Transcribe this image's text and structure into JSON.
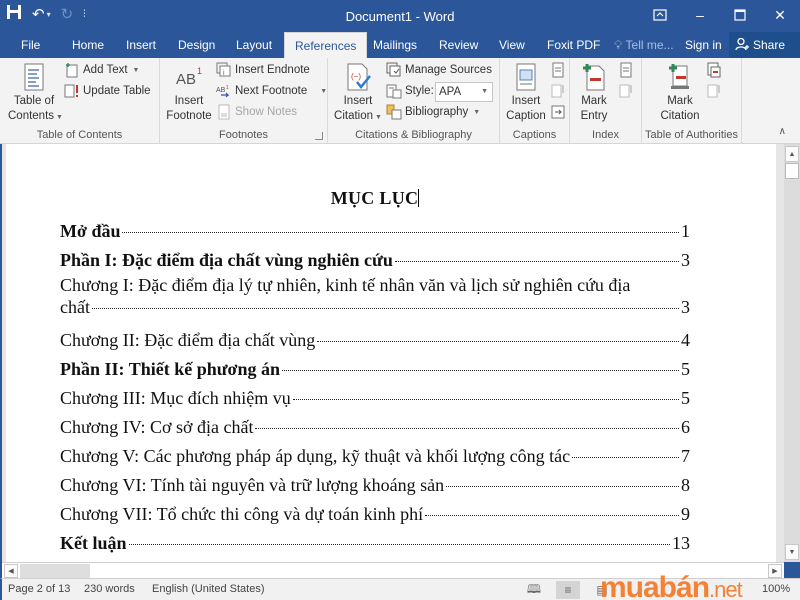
{
  "window": {
    "title": "Document1 - Word",
    "controls": [
      "ribbon-display-options",
      "minimize",
      "maximize",
      "close"
    ]
  },
  "qat": {
    "save_icon": "save-icon",
    "undo_icon": "undo-icon",
    "redo_icon": "redo-icon",
    "customize_icon": "customize-qat-icon"
  },
  "tabs": [
    {
      "label": "File"
    },
    {
      "label": "Home"
    },
    {
      "label": "Insert"
    },
    {
      "label": "Design"
    },
    {
      "label": "Layout"
    },
    {
      "label": "References",
      "active": true
    },
    {
      "label": "Mailings"
    },
    {
      "label": "Review"
    },
    {
      "label": "View"
    },
    {
      "label": "Foxit PDF"
    }
  ],
  "tell_me": "Tell me...",
  "sign_in": "Sign in",
  "share": "Share",
  "ribbon": {
    "groups": {
      "toc": {
        "label": "Table of Contents",
        "toc_button_line1": "Table of",
        "toc_button_line2": "Contents",
        "add_text": "Add Text",
        "update_table": "Update Table"
      },
      "footnotes": {
        "label": "Footnotes",
        "insert_footnote_line1": "Insert",
        "insert_footnote_line2": "Footnote",
        "insert_endnote": "Insert Endnote",
        "next_footnote": "Next Footnote",
        "show_notes": "Show Notes"
      },
      "citations": {
        "label": "Citations & Bibliography",
        "insert_citation_line1": "Insert",
        "insert_citation_line2": "Citation",
        "manage_sources": "Manage Sources",
        "style_label": "Style:",
        "style_value": "APA",
        "bibliography": "Bibliography"
      },
      "captions": {
        "label": "Captions",
        "insert_caption_line1": "Insert",
        "insert_caption_line2": "Caption"
      },
      "index": {
        "label": "Index",
        "mark_entry_line1": "Mark",
        "mark_entry_line2": "Entry"
      },
      "authorities": {
        "label": "Table of Authorities",
        "mark_citation_line1": "Mark",
        "mark_citation_line2": "Citation"
      }
    }
  },
  "document": {
    "title": "MỤC LỤC",
    "toc": [
      {
        "text": "Mở đầu",
        "page": "1",
        "bold": true
      },
      {
        "text": "Phần I: Đặc điểm địa chất vùng nghiên cứu",
        "page": "3",
        "bold": true
      },
      {
        "text": "Chương I: Đặc điểm địa lý tự nhiên, kinh tế nhân văn và lịch sử nghiên cứu địa",
        "text_cont": "chất",
        "page": "3",
        "bold": false
      },
      {
        "text": "Chương II: Đặc điểm địa chất vùng",
        "page": "4",
        "bold": false
      },
      {
        "text": "Phần II: Thiết kế phương án",
        "page": "5",
        "bold": true
      },
      {
        "text": "Chương III: Mục đích nhiệm vụ",
        "page": "5",
        "bold": false
      },
      {
        "text": "Chương IV: Cơ sở địa chất",
        "page": "6",
        "bold": false
      },
      {
        "text": "Chương V: Các phương pháp áp dụng, kỹ thuật và khối lượng công tác",
        "page": "7",
        "bold": false
      },
      {
        "text": "Chương VI: Tính tài nguyên và trữ lượng khoáng sản",
        "page": "8",
        "bold": false
      },
      {
        "text": "Chương VII: Tổ chức thi công và dự toán kinh phí",
        "page": "9",
        "bold": false
      },
      {
        "text": "Kết luận",
        "page": "13",
        "bold": true
      }
    ]
  },
  "status": {
    "page": "Page 2 of 13",
    "words": "230 words",
    "language": "English (United States)",
    "zoom": "100%"
  },
  "watermark": {
    "brand": "muabán",
    "tld": ".net"
  },
  "colors": {
    "accent": "#2b579a",
    "ribbon_bg": "#f3f3f3",
    "watermark": "#f57c2b"
  }
}
